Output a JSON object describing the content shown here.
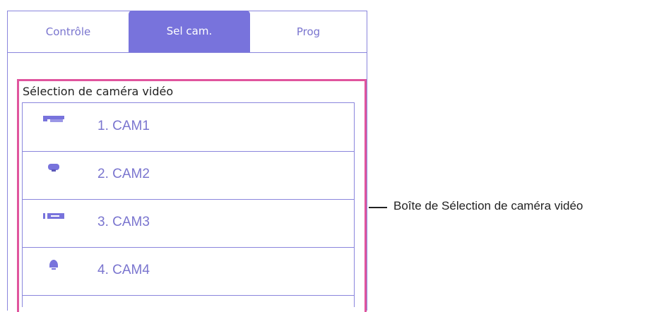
{
  "tabs": [
    {
      "label": "Contrôle"
    },
    {
      "label": "Sel cam."
    },
    {
      "label": "Prog"
    }
  ],
  "selection": {
    "title": "Sélection de caméra vidéo",
    "cameras": [
      {
        "label": "1. CAM1",
        "icon": "box-camera-icon"
      },
      {
        "label": "2. CAM2",
        "icon": "dome-camera-icon"
      },
      {
        "label": "3. CAM3",
        "icon": "bullet-camera-icon"
      },
      {
        "label": "4. CAM4",
        "icon": "ptz-camera-icon"
      }
    ]
  },
  "callout": {
    "text": "Boîte de Sélection de caméra vidéo"
  },
  "colors": {
    "accent": "#7873dc",
    "highlight": "#e0559e",
    "border": "#8a86dd"
  }
}
